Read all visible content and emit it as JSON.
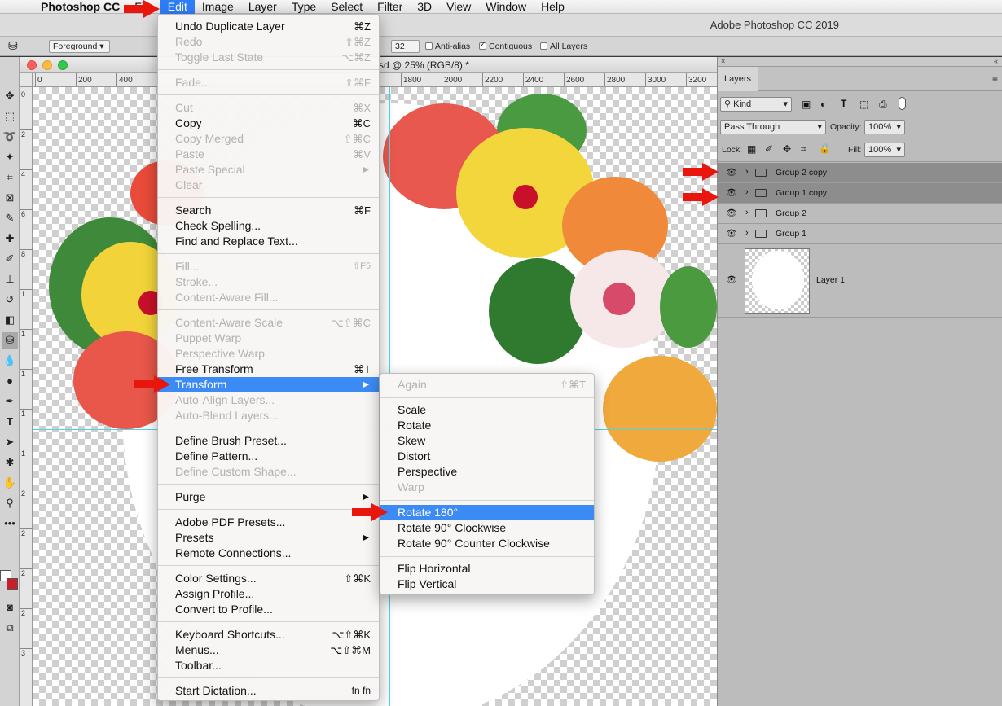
{
  "menubar": {
    "app_name": "Photoshop CC",
    "items": [
      "File",
      "Edit",
      "Image",
      "Layer",
      "Type",
      "Select",
      "Filter",
      "3D",
      "View",
      "Window",
      "Help"
    ]
  },
  "app_title": "Adobe Photoshop CC 2019",
  "options": {
    "preset": "Foreground",
    "tolerance_partial": "32",
    "anti_alias": "Anti-alias",
    "contiguous": "Contiguous",
    "all_layers": "All Layers"
  },
  "document": {
    "title": "sd @ 25% (RGB/8) *",
    "ruler_h": [
      "0",
      "200",
      "400",
      "1800",
      "2000",
      "2200",
      "2400",
      "2600",
      "2800",
      "3000",
      "3200"
    ],
    "ruler_v": [
      "0",
      "2",
      "4",
      "6",
      "8",
      "1",
      "1",
      "1",
      "1",
      "1",
      "2",
      "2",
      "2",
      "2",
      "3",
      "3",
      "3"
    ]
  },
  "edit_menu": {
    "items": [
      {
        "label": "Undo Duplicate Layer",
        "shortcut": "⌘Z",
        "disabled": false
      },
      {
        "label": "Redo",
        "shortcut": "⇧⌘Z",
        "disabled": true
      },
      {
        "label": "Toggle Last State",
        "shortcut": "⌥⌘Z",
        "disabled": true
      },
      {
        "label": "Fade...",
        "shortcut": "⇧⌘F",
        "disabled": true
      },
      {
        "label": "Cut",
        "shortcut": "⌘X",
        "disabled": true
      },
      {
        "label": "Copy",
        "shortcut": "⌘C",
        "disabled": false
      },
      {
        "label": "Copy Merged",
        "shortcut": "⇧⌘C",
        "disabled": true
      },
      {
        "label": "Paste",
        "shortcut": "⌘V",
        "disabled": true
      },
      {
        "label": "Paste Special",
        "shortcut": "",
        "disabled": true
      },
      {
        "label": "Clear",
        "shortcut": "",
        "disabled": true
      },
      {
        "label": "Search",
        "shortcut": "⌘F",
        "disabled": false
      },
      {
        "label": "Check Spelling...",
        "shortcut": "",
        "disabled": false
      },
      {
        "label": "Find and Replace Text...",
        "shortcut": "",
        "disabled": false
      },
      {
        "label": "Fill...",
        "shortcut": "⇧F5",
        "disabled": true
      },
      {
        "label": "Stroke...",
        "shortcut": "",
        "disabled": true
      },
      {
        "label": "Content-Aware Fill...",
        "shortcut": "",
        "disabled": true
      },
      {
        "label": "Content-Aware Scale",
        "shortcut": "⌥⇧⌘C",
        "disabled": true
      },
      {
        "label": "Puppet Warp",
        "shortcut": "",
        "disabled": true
      },
      {
        "label": "Perspective Warp",
        "shortcut": "",
        "disabled": true
      },
      {
        "label": "Free Transform",
        "shortcut": "⌘T",
        "disabled": false
      },
      {
        "label": "Transform",
        "shortcut": "",
        "disabled": false
      },
      {
        "label": "Auto-Align Layers...",
        "shortcut": "",
        "disabled": true
      },
      {
        "label": "Auto-Blend Layers...",
        "shortcut": "",
        "disabled": true
      },
      {
        "label": "Define Brush Preset...",
        "shortcut": "",
        "disabled": false
      },
      {
        "label": "Define Pattern...",
        "shortcut": "",
        "disabled": false
      },
      {
        "label": "Define Custom Shape...",
        "shortcut": "",
        "disabled": true
      },
      {
        "label": "Purge",
        "shortcut": "",
        "disabled": false
      },
      {
        "label": "Adobe PDF Presets...",
        "shortcut": "",
        "disabled": false
      },
      {
        "label": "Presets",
        "shortcut": "",
        "disabled": false
      },
      {
        "label": "Remote Connections...",
        "shortcut": "",
        "disabled": false
      },
      {
        "label": "Color Settings...",
        "shortcut": "⇧⌘K",
        "disabled": false
      },
      {
        "label": "Assign Profile...",
        "shortcut": "",
        "disabled": false
      },
      {
        "label": "Convert to Profile...",
        "shortcut": "",
        "disabled": false
      },
      {
        "label": "Keyboard Shortcuts...",
        "shortcut": "⌥⇧⌘K",
        "disabled": false
      },
      {
        "label": "Menus...",
        "shortcut": "⌥⇧⌘M",
        "disabled": false
      },
      {
        "label": "Toolbar...",
        "shortcut": "",
        "disabled": false
      },
      {
        "label": "Start Dictation...",
        "shortcut": "fn fn",
        "disabled": false
      }
    ]
  },
  "transform_menu": {
    "items": [
      {
        "label": "Again",
        "shortcut": "⇧⌘T",
        "disabled": true
      },
      {
        "label": "Scale",
        "shortcut": "",
        "disabled": false
      },
      {
        "label": "Rotate",
        "shortcut": "",
        "disabled": false
      },
      {
        "label": "Skew",
        "shortcut": "",
        "disabled": false
      },
      {
        "label": "Distort",
        "shortcut": "",
        "disabled": false
      },
      {
        "label": "Perspective",
        "shortcut": "",
        "disabled": false
      },
      {
        "label": "Warp",
        "shortcut": "",
        "disabled": true
      },
      {
        "label": "Rotate 180°",
        "shortcut": "",
        "disabled": false
      },
      {
        "label": "Rotate 90° Clockwise",
        "shortcut": "",
        "disabled": false
      },
      {
        "label": "Rotate 90° Counter Clockwise",
        "shortcut": "",
        "disabled": false
      },
      {
        "label": "Flip Horizontal",
        "shortcut": "",
        "disabled": false
      },
      {
        "label": "Flip Vertical",
        "shortcut": "",
        "disabled": false
      }
    ]
  },
  "layers_panel": {
    "tab": "Layers",
    "filter": "Kind",
    "blend_mode": "Pass Through",
    "opacity_label": "Opacity:",
    "opacity": "100%",
    "lock_label": "Lock:",
    "fill_label": "Fill:",
    "fill": "100%",
    "layers": [
      {
        "name": "Group 2 copy",
        "selected": true
      },
      {
        "name": "Group 1 copy",
        "selected": true
      },
      {
        "name": "Group 2",
        "selected": false
      },
      {
        "name": "Group 1",
        "selected": false
      },
      {
        "name": "Layer 1",
        "selected": false
      }
    ]
  },
  "colors": {
    "highlight": "#3c8bf5",
    "arrow": "#e8160c",
    "guide": "#4fd3ea"
  }
}
